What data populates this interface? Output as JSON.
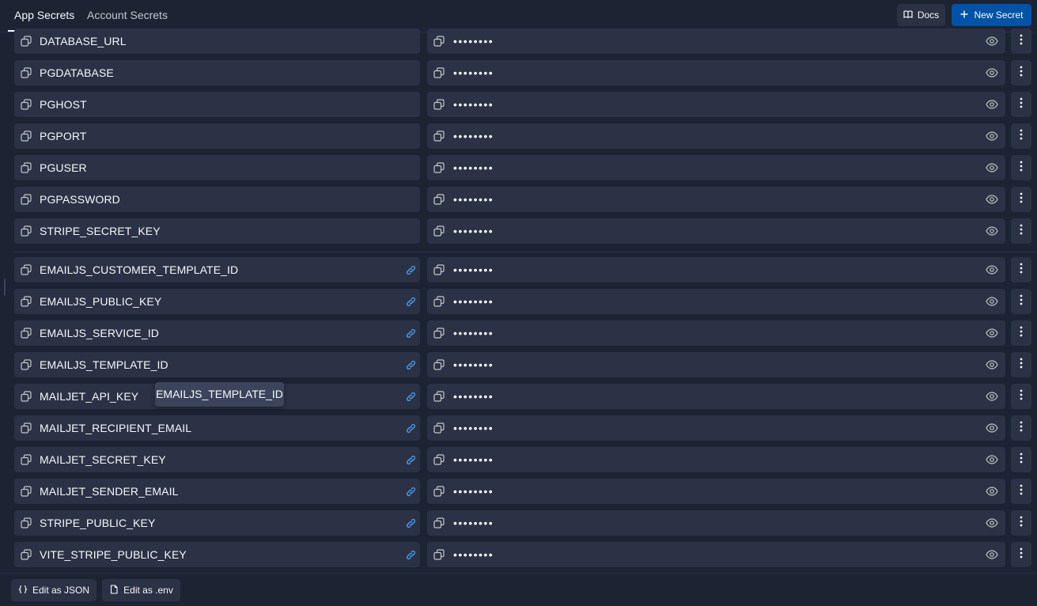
{
  "tabs": {
    "app_secrets": "App Secrets",
    "account_secrets": "Account Secrets"
  },
  "header_actions": {
    "docs_label": "Docs",
    "new_secret_label": "New Secret"
  },
  "secrets": [
    {
      "key": "DATABASE_URL",
      "value": "••••••••",
      "linked": false
    },
    {
      "key": "PGDATABASE",
      "value": "••••••••",
      "linked": false
    },
    {
      "key": "PGHOST",
      "value": "••••••••",
      "linked": false
    },
    {
      "key": "PGPORT",
      "value": "••••••••",
      "linked": false
    },
    {
      "key": "PGUSER",
      "value": "••••••••",
      "linked": false
    },
    {
      "key": "PGPASSWORD",
      "value": "••••••••",
      "linked": false
    },
    {
      "key": "STRIPE_SECRET_KEY",
      "value": "••••••••",
      "linked": false
    },
    {
      "key": "EMAILJS_CUSTOMER_TEMPLATE_ID",
      "value": "••••••••",
      "linked": true
    },
    {
      "key": "EMAILJS_PUBLIC_KEY",
      "value": "••••••••",
      "linked": true
    },
    {
      "key": "EMAILJS_SERVICE_ID",
      "value": "••••••••",
      "linked": true
    },
    {
      "key": "EMAILJS_TEMPLATE_ID",
      "value": "••••••••",
      "linked": true
    },
    {
      "key": "MAILJET_API_KEY",
      "value": "••••••••",
      "linked": true
    },
    {
      "key": "MAILJET_RECIPIENT_EMAIL",
      "value": "••••••••",
      "linked": true
    },
    {
      "key": "MAILJET_SECRET_KEY",
      "value": "••••••••",
      "linked": true
    },
    {
      "key": "MAILJET_SENDER_EMAIL",
      "value": "••••••••",
      "linked": true
    },
    {
      "key": "STRIPE_PUBLIC_KEY",
      "value": "••••••••",
      "linked": true
    },
    {
      "key": "VITE_STRIPE_PUBLIC_KEY",
      "value": "••••••••",
      "linked": true
    }
  ],
  "tooltip": {
    "text": "EMAILJS_TEMPLATE_ID"
  },
  "footer": {
    "edit_json_label": "Edit as JSON",
    "edit_env_label": "Edit as .env"
  },
  "icons": {
    "copy": "copy-icon",
    "link": "link-icon",
    "eye": "eye-icon",
    "more": "more-vertical-icon",
    "book": "book-icon",
    "plus": "plus-icon",
    "braces": "braces-icon",
    "file": "file-icon"
  },
  "colors": {
    "background": "#1c2333",
    "surface": "#2b3245",
    "primary": "#0053a6",
    "link": "#4da3ff",
    "text": "#f5f9fc"
  }
}
